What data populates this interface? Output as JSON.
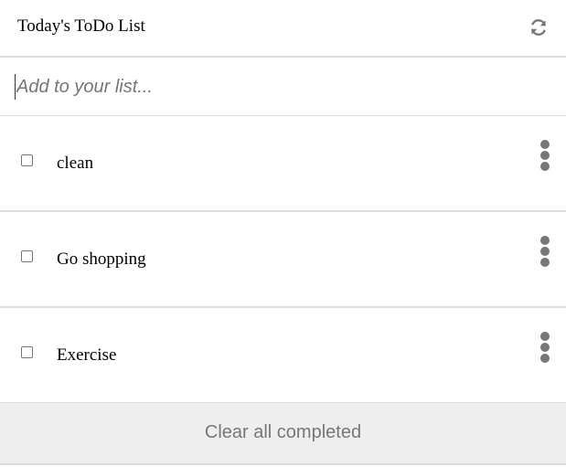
{
  "header": {
    "title": "Today's ToDo List",
    "refresh_icon": "refresh-icon"
  },
  "add": {
    "placeholder": "Add to your list...",
    "value": ""
  },
  "todos": [
    {
      "label": "clean",
      "checked": false,
      "menu_icon": "more-vertical-icon"
    },
    {
      "label": "Go shopping",
      "checked": false,
      "menu_icon": "more-vertical-icon"
    },
    {
      "label": "Exercise",
      "checked": false,
      "menu_icon": "more-vertical-icon"
    }
  ],
  "footer": {
    "clear_label": "Clear all completed"
  },
  "colors": {
    "icon": "#777777",
    "divider": "#dcdcdc",
    "footer_bg": "#eeeeee",
    "footer_text": "#777777"
  }
}
